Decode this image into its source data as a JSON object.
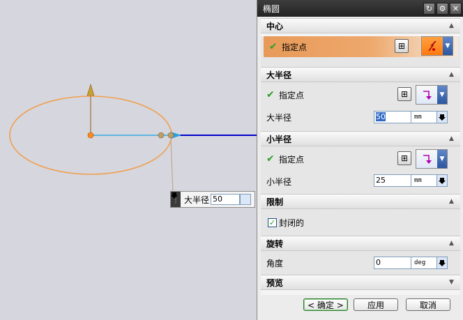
{
  "viewport": {
    "float_input": {
      "label": "大半径",
      "value": "50"
    }
  },
  "dialog": {
    "title": "椭圆",
    "title_buttons": [
      "reset-icon",
      "gear-icon",
      "close-icon"
    ],
    "sections": {
      "center": {
        "header": "中心",
        "point_label": "指定点"
      },
      "major": {
        "header": "大半径",
        "point_label": "指定点",
        "radius_label": "大半径",
        "radius_value": "50",
        "unit": "mm"
      },
      "minor": {
        "header": "小半径",
        "point_label": "指定点",
        "radius_label": "小半径",
        "radius_value": "25",
        "unit": "mm"
      },
      "limit": {
        "header": "限制",
        "closed_label": "封闭的",
        "closed_checked": true
      },
      "rotation": {
        "header": "旋转",
        "angle_label": "角度",
        "angle_value": "0",
        "unit": "deg"
      },
      "preview": {
        "header": "预览"
      }
    },
    "buttons": {
      "ok": "< 确定 >",
      "apply": "应用",
      "cancel": "取消"
    }
  },
  "colors": {
    "ellipse": "#f0a050",
    "axis": "#0000cc",
    "titlebar": "#2a2a2a",
    "active_row": "#e79a59"
  }
}
